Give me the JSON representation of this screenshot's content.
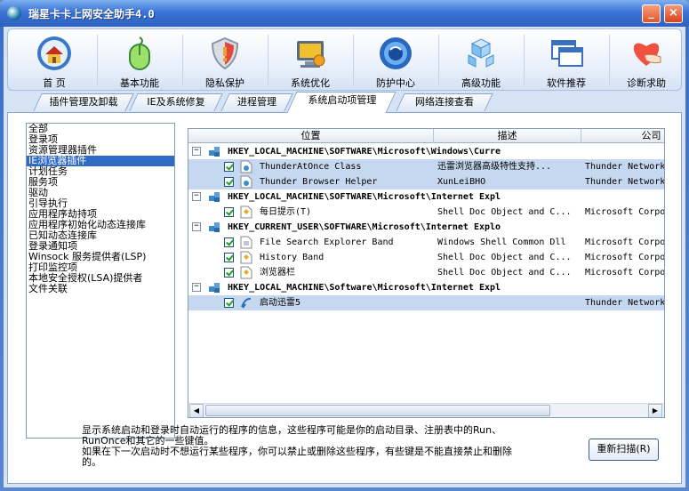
{
  "window": {
    "title": "瑞星卡卡上网安全助手4.0",
    "min_label": "_",
    "close_label": "×"
  },
  "toolbar": [
    {
      "label": "首 页",
      "icon": "home-icon"
    },
    {
      "label": "基本功能",
      "icon": "mouse-icon"
    },
    {
      "label": "隐私保护",
      "icon": "shield-icon"
    },
    {
      "label": "系统优化",
      "icon": "monitor-icon"
    },
    {
      "label": "防护中心",
      "icon": "globe-icon"
    },
    {
      "label": "高级功能",
      "icon": "cubes-icon"
    },
    {
      "label": "软件推荐",
      "icon": "windows-icon"
    },
    {
      "label": "诊断求助",
      "icon": "heart-hand-icon"
    }
  ],
  "tabs": [
    {
      "label": "插件管理及卸载"
    },
    {
      "label": "IE及系统修复"
    },
    {
      "label": "进程管理"
    },
    {
      "label": "系统启动项管理"
    },
    {
      "label": "网络连接查看"
    }
  ],
  "active_tab": 3,
  "categories": [
    "全部",
    "登录项",
    "资源管理器插件",
    "IE浏览器插件",
    "计划任务",
    "服务项",
    "驱动",
    "引导执行",
    "应用程序劫持项",
    "应用程序初始化动态连接库",
    "已知动态连接库",
    "登录通知项",
    "Winsock 服务提供者(LSP)",
    "打印监控项",
    "本地安全授权(LSA)提供者",
    "文件关联"
  ],
  "selected_category": 3,
  "grid": {
    "columns": [
      "位置",
      "描述",
      "公司"
    ],
    "groups": [
      {
        "key": "HKEY_LOCAL_MACHINE\\SOFTWARE\\Microsoft\\Windows\\Curre",
        "items": [
          {
            "name": "ThunderAtOnce Class",
            "desc": "迅雷浏览器高级特性支持...",
            "company": "Thunder Network",
            "highlight": true
          },
          {
            "name": "Thunder Browser Helper",
            "desc": "XunLeiBHO",
            "company": "Thunder Network",
            "highlight": true
          }
        ]
      },
      {
        "key": "HKEY_LOCAL_MACHINE\\SOFTWARE\\Microsoft\\Internet Expl",
        "items": [
          {
            "name": "每日提示(T)",
            "desc": "Shell Doc Object and C...",
            "company": "Microsoft Corpo",
            "highlight": false
          }
        ]
      },
      {
        "key": "HKEY_CURRENT_USER\\SOFTWARE\\Microsoft\\Internet Explo",
        "items": [
          {
            "name": "File Search Explorer Band",
            "desc": "Windows Shell Common Dll",
            "company": "Microsoft Corpo",
            "highlight": false
          },
          {
            "name": "History Band",
            "desc": "Shell Doc Object and C...",
            "company": "Microsoft Corpo",
            "highlight": false
          },
          {
            "name": "浏览器栏",
            "desc": "Shell Doc Object and C...",
            "company": "Microsoft Corpo",
            "highlight": false
          }
        ]
      },
      {
        "key": "HKEY_LOCAL_MACHINE\\Software\\Microsoft\\Internet Expl",
        "items": [
          {
            "name": "启动迅雷5",
            "desc": "",
            "company": "Thunder Network",
            "highlight": true
          }
        ]
      }
    ]
  },
  "description": {
    "line1": "显示系统启动和登录时自动运行的程序的信息，这些程序可能是你的启动目录、注册表中的Run、",
    "line2": "RunOnce和其它的一些键值。",
    "line3": "如果在下一次启动时不想运行某些程序，你可以禁止或删除这些程序，有些键是不能直接禁止和删除",
    "line4": "的。"
  },
  "rescan_label": "重新扫描(R)"
}
